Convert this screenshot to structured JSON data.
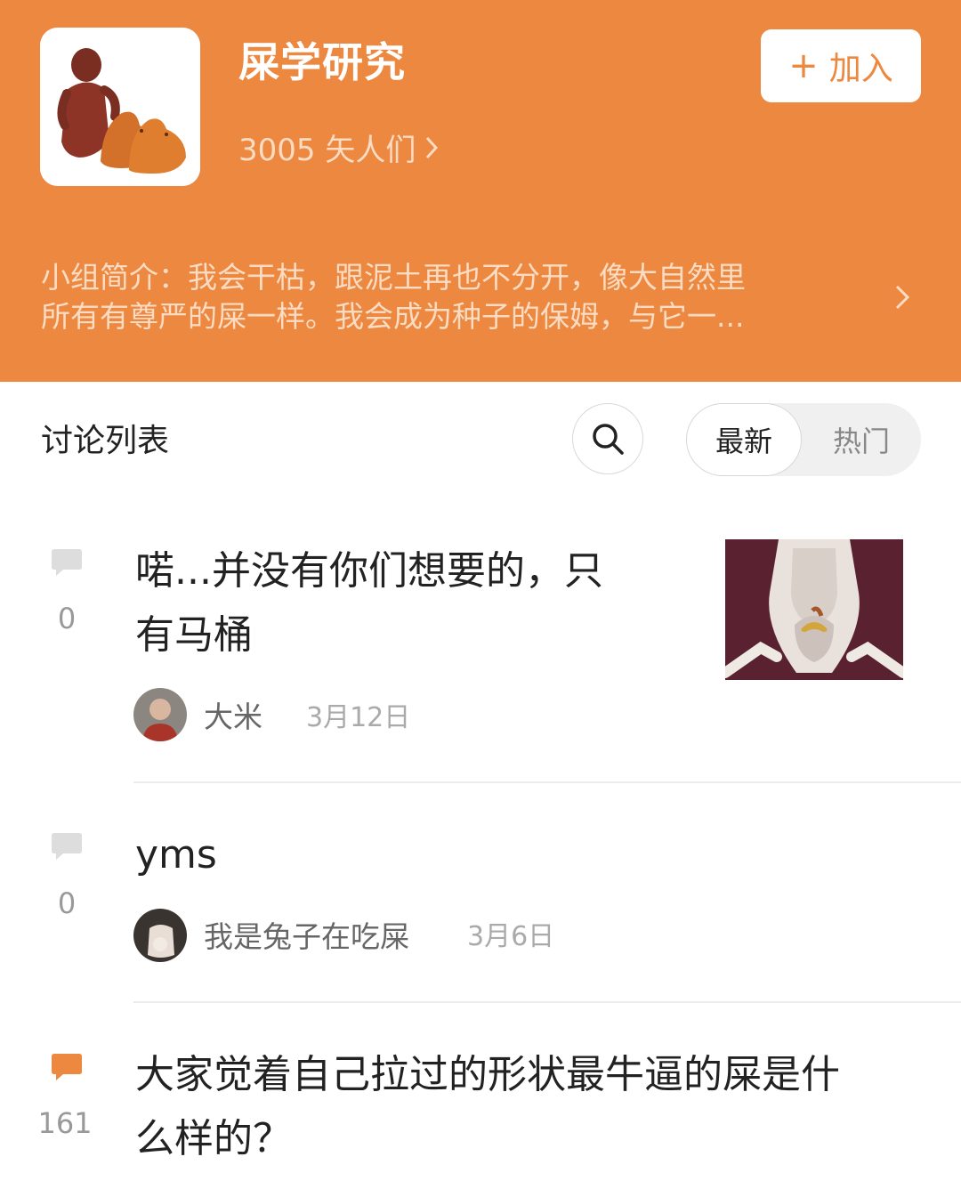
{
  "group": {
    "name": "屎学研究",
    "members": "3005 矢人们",
    "join_label": "加入",
    "intro_label": "小组简介：",
    "intro_line1": "我会干枯，跟泥土再也不分开，像大自然里",
    "intro_line2": "所有有尊严的屎一样。我会成为种子的保姆，与它一...",
    "avatar_icon": "clay-figure-avatar"
  },
  "list": {
    "title": "讨论列表",
    "sort_latest": "最新",
    "sort_hot": "热门",
    "active_sort": "最新"
  },
  "posts": [
    {
      "comment_count": "0",
      "title_line1": "喏...并没有你们想要的，只",
      "title_line2": "有马桶",
      "author": "大米",
      "date": "3月12日",
      "bubble_color": "#dddddd",
      "has_thumbnail": true
    },
    {
      "comment_count": "0",
      "title_line1": "yms",
      "author": "我是兔子在吃屎",
      "date": "3月6日",
      "bubble_color": "#dddddd"
    },
    {
      "comment_count": "161",
      "title_line1": "大家觉着自己拉过的形状最牛逼的屎是什",
      "title_line2": "么样的？",
      "bubble_color": "#EC8840"
    }
  ],
  "colors": {
    "header": "#EC8840",
    "accent": "#EC8840",
    "text_primary": "#222222",
    "text_secondary": "#999999"
  }
}
